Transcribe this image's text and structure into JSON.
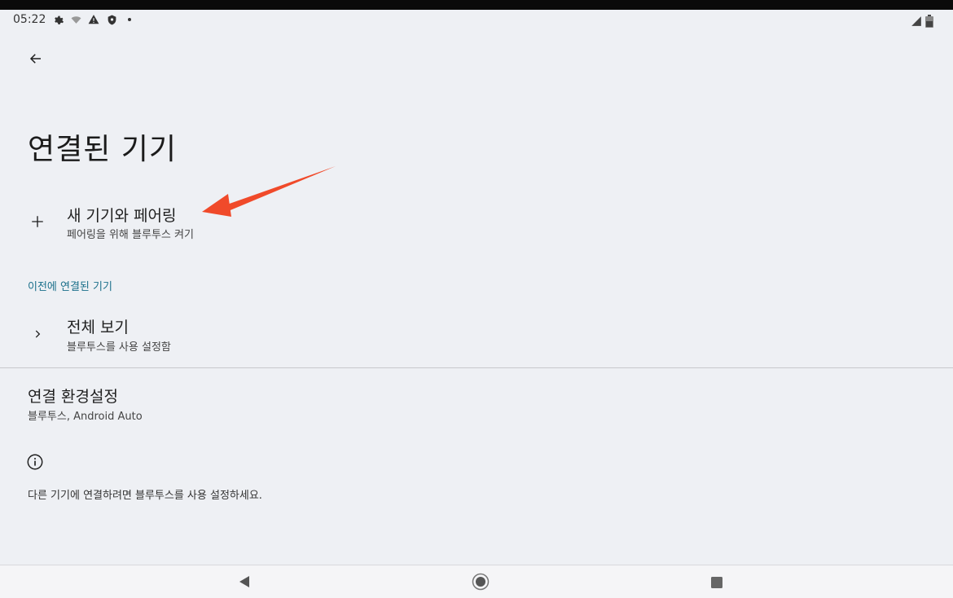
{
  "status_bar": {
    "time": "05:22",
    "icons_left": [
      "settings-icon",
      "wifi-off-icon",
      "warning-icon",
      "shield-icon",
      "dot-icon"
    ],
    "icons_right": [
      "network-icon",
      "battery-icon"
    ]
  },
  "header": {
    "back_icon": "arrow-back-icon",
    "title": "연결된 기기"
  },
  "pair_new": {
    "icon": "plus-icon",
    "title": "새 기기와 페어링",
    "subtitle": "페어링을 위해 블루투스 켜기"
  },
  "previous_section": {
    "header": "이전에 연결된 기기",
    "see_all": {
      "icon": "chevron-right-icon",
      "title": "전체 보기",
      "subtitle": "블루투스를 사용 설정함"
    }
  },
  "connection_prefs": {
    "title": "연결 환경설정",
    "subtitle": "블루투스, Android Auto"
  },
  "info": {
    "icon": "info-icon",
    "text": "다른 기기에 연결하려면 블루투스를 사용 설정하세요."
  },
  "nav_bar": {
    "back_icon": "nav-back-icon",
    "home_icon": "nav-home-icon",
    "recents_icon": "nav-recents-icon"
  },
  "colors": {
    "background": "#eef0f4",
    "section_header": "#1a6f8a",
    "annotation_arrow": "#f04a2a"
  }
}
